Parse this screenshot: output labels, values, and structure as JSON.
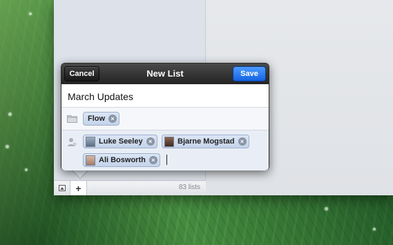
{
  "toolbar": {
    "cancel_label": "Cancel",
    "title": "New List",
    "save_label": "Save"
  },
  "list_name": {
    "value": "March Updates"
  },
  "folder": {
    "token_label": "Flow"
  },
  "people": [
    {
      "name": "Luke Seeley",
      "avatar_color": "#7d8ea3"
    },
    {
      "name": "Bjarne Mogstad",
      "avatar_color": "#6b4a3a"
    },
    {
      "name": "Ali Bosworth",
      "avatar_color": "#b48a78"
    }
  ],
  "footer": {
    "add_label": "+",
    "count_label": "83 lists"
  },
  "colors": {
    "save_blue": "#1463e3",
    "header_dark": "#232323",
    "token_bg": "#c4d4ea"
  },
  "icons": {
    "folder": "folder-icon",
    "person": "person-icon",
    "remove": "remove-token-icon",
    "photo": "photo-icon"
  }
}
